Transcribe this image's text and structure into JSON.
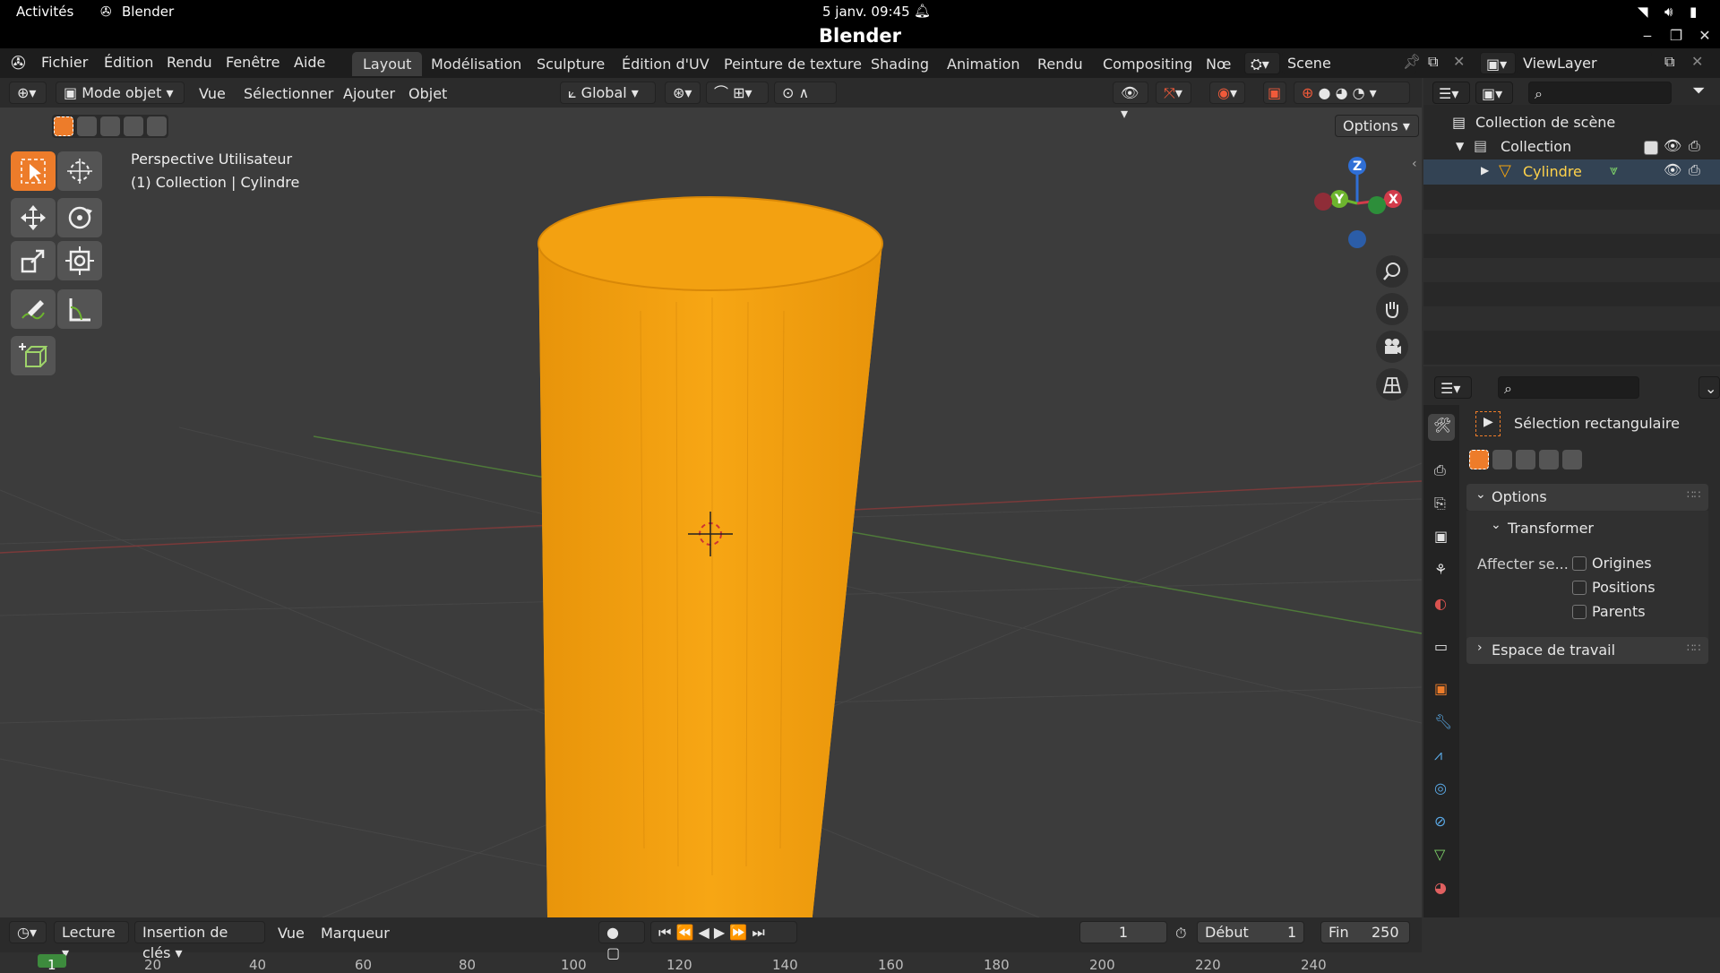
{
  "gnome": {
    "activities": "Activités",
    "app": "Blender",
    "datetime": "5 janv.  09:45"
  },
  "window": {
    "title": "Blender"
  },
  "menus": [
    "Fichier",
    "Édition",
    "Rendu",
    "Fenêtre",
    "Aide"
  ],
  "workspaces": [
    "Layout",
    "Modélisation",
    "Sculpture",
    "Édition d'UV",
    "Peinture de texture",
    "Shading",
    "Animation",
    "Rendu",
    "Compositing",
    "Nœ"
  ],
  "scene": {
    "name": "Scene",
    "view_layer": "ViewLayer"
  },
  "viewport_header": {
    "mode": "Mode objet",
    "menus": [
      "Vue",
      "Sélectionner",
      "Ajouter",
      "Objet"
    ],
    "orientation": "Global",
    "options": "Options"
  },
  "viewport_info": {
    "view": "Perspective Utilisateur",
    "object": "(1) Collection | Cylindre"
  },
  "gizmo": {
    "z": "Z",
    "y": "Y",
    "x": "X"
  },
  "outliner": {
    "scene_collection": "Collection de scène",
    "collection": "Collection",
    "object": "Cylindre"
  },
  "tool_settings": {
    "tool_name": "Sélection rectangulaire",
    "options": "Options",
    "transform": "Transformer",
    "affect_label": "Affecter se...",
    "checks": [
      "Origines",
      "Positions",
      "Parents"
    ],
    "workspace": "Espace de travail"
  },
  "timeline": {
    "playback": "Lecture",
    "keying": "Insertion de clés",
    "view": "Vue",
    "marker": "Marqueur",
    "current_frame": "1",
    "start_label": "Début",
    "start": "1",
    "end_label": "Fin",
    "end": "250",
    "ticks": [
      "1",
      "20",
      "40",
      "60",
      "80",
      "100",
      "120",
      "140",
      "160",
      "180",
      "200",
      "220",
      "240"
    ]
  },
  "colors": {
    "accent": "#ed7c2a",
    "object": "#f5a40e",
    "selected_text": "#ffd24a",
    "bg": "#3c3c3c"
  }
}
